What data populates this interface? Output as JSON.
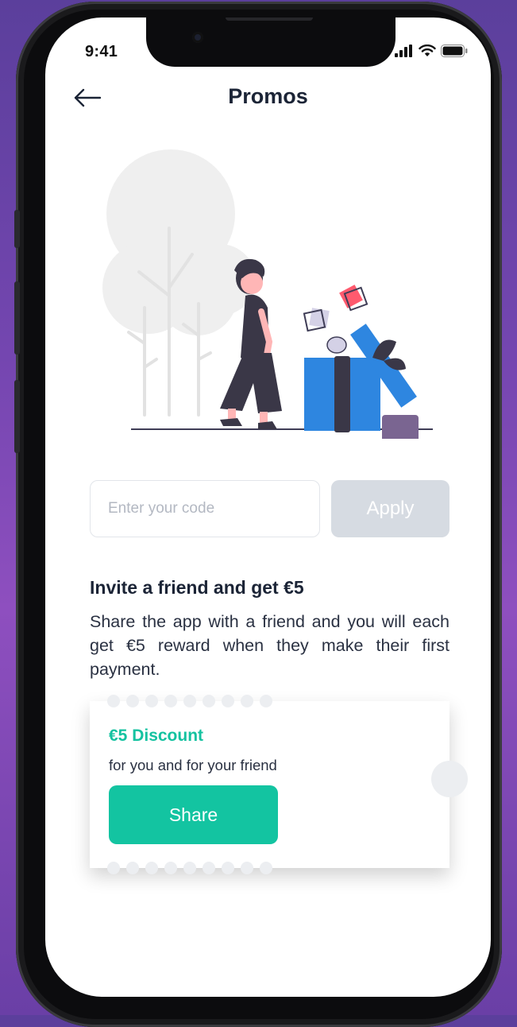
{
  "status_bar": {
    "time": "9:41"
  },
  "header": {
    "title": "Promos"
  },
  "promo_code": {
    "placeholder": "Enter your code",
    "value": "",
    "apply_label": "Apply"
  },
  "invite": {
    "title": "Invite a friend and get €5",
    "description": "Share the app with a friend and you will each get €5 reward when they make their first payment."
  },
  "coupon": {
    "title": "€5 Discount",
    "subtitle": "for you and for your friend",
    "share_label": "Share"
  },
  "icons": [
    "back-arrow-icon",
    "signal-icon",
    "wifi-icon",
    "battery-icon"
  ],
  "colors": {
    "accent": "#13c4a1",
    "apply_disabled": "#d6dbe2",
    "text_dark": "#1b2436",
    "gift_blue": "#2e86e0"
  }
}
